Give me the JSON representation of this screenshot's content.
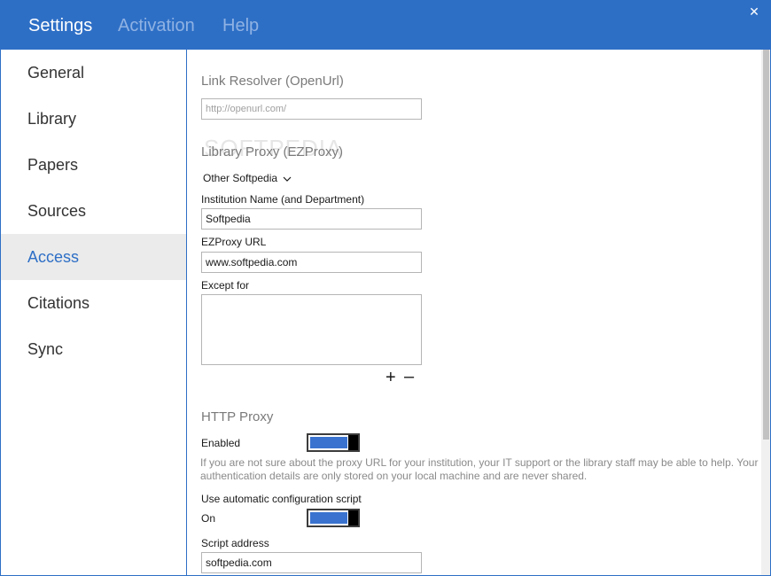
{
  "header": {
    "tabs": [
      {
        "label": "Settings"
      },
      {
        "label": "Activation"
      },
      {
        "label": "Help"
      }
    ],
    "close_glyph": "✕"
  },
  "sidebar": {
    "items": [
      {
        "label": "General"
      },
      {
        "label": "Library"
      },
      {
        "label": "Papers"
      },
      {
        "label": "Sources"
      },
      {
        "label": "Access"
      },
      {
        "label": "Citations"
      },
      {
        "label": "Sync"
      }
    ],
    "selected": "Access"
  },
  "watermark": "SOFTPEDIA",
  "link_resolver": {
    "title": "Link Resolver (OpenUrl)",
    "placeholder": "http://openurl.com/"
  },
  "library_proxy": {
    "title": "Library Proxy (EZProxy)",
    "dropdown_value": "Other Softpedia",
    "institution_label": "Institution Name (and Department)",
    "institution_value": "Softpedia",
    "ezproxy_label": "EZProxy URL",
    "ezproxy_value": "www.softpedia.com",
    "except_label": "Except for",
    "add_glyph": "+",
    "remove_glyph": "–"
  },
  "http_proxy": {
    "title": "HTTP Proxy",
    "enabled_label": "Enabled",
    "help_text": "If you are not sure about the proxy URL for your institution, your IT support or the library staff may be able to help. Your authentication details are only stored on your local machine and are never shared.",
    "auto_config_label": "Use automatic configuration script",
    "on_label": "On",
    "script_address_label": "Script address",
    "script_address_value": "softpedia.com"
  },
  "colors": {
    "accent": "#2e6fc6",
    "toggle_fill": "#3a73cf",
    "selected_bg": "#ebebeb"
  }
}
